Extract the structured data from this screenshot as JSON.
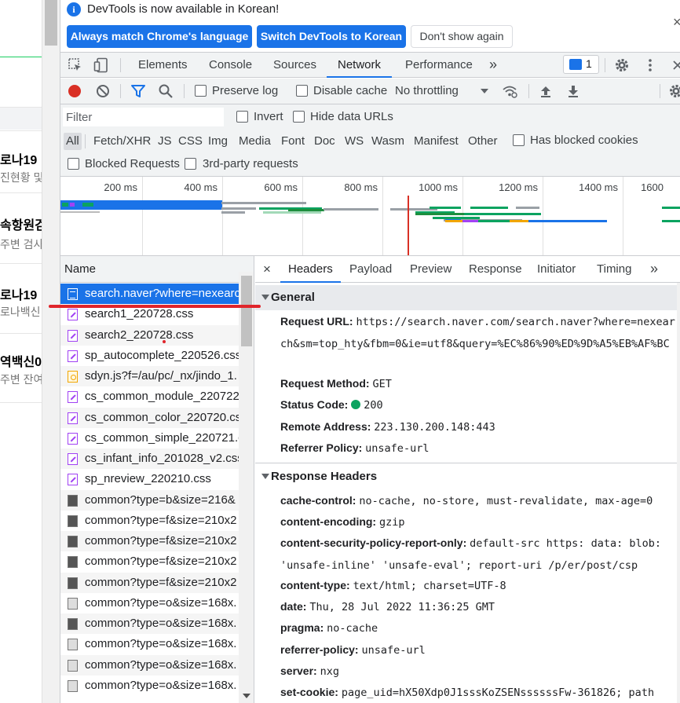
{
  "page_strip": {
    "items": [
      {
        "title": "로나19",
        "sub": "진현황 및"
      },
      {
        "title": "속항원검",
        "sub": "주변 검사"
      },
      {
        "title": "로나19 ",
        "sub": "로나백신"
      },
      {
        "title": "역백신0",
        "sub": "주변 잔여"
      }
    ]
  },
  "infobar": {
    "message": "DevTools is now available in Korean!",
    "btn_match": "Always match Chrome's language",
    "btn_switch": "Switch DevTools to Korean",
    "btn_dismiss": "Don't show again",
    "close": "×"
  },
  "main_tabs": {
    "items": [
      "Elements",
      "Console",
      "Sources",
      "Network",
      "Performance"
    ],
    "active": "Network",
    "more": "»",
    "issues_count": "1"
  },
  "toolbar": {
    "preserve_log": "Preserve log",
    "disable_cache": "Disable cache",
    "throttling": "No throttling"
  },
  "filter": {
    "placeholder": "Filter",
    "invert": "Invert",
    "hide_data_urls": "Hide data URLs",
    "types": [
      "All",
      "Fetch/XHR",
      "JS",
      "CSS",
      "Img",
      "Media",
      "Font",
      "Doc",
      "WS",
      "Wasm",
      "Manifest",
      "Other"
    ],
    "active_type": "All",
    "has_blocked_cookies": "Has blocked cookies",
    "blocked_requests": "Blocked Requests",
    "third_party": "3rd-party requests"
  },
  "overview": {
    "ticks": [
      "200 ms",
      "400 ms",
      "600 ms",
      "800 ms",
      "1000 ms",
      "1200 ms",
      "1400 ms",
      "1600"
    ]
  },
  "request_list": {
    "header": "Name",
    "rows": [
      {
        "name": "search.naver?where=nexearch",
        "type": "doc"
      },
      {
        "name": "search1_220728.css",
        "type": "css"
      },
      {
        "name": "search2_220728.css",
        "type": "css"
      },
      {
        "name": "sp_autocomplete_220526.css",
        "type": "css"
      },
      {
        "name": "sdyn.js?f=/au/pc/_nx/jindo_1.",
        "type": "js"
      },
      {
        "name": "cs_common_module_220722.",
        "type": "css"
      },
      {
        "name": "cs_common_color_220720.css",
        "type": "css"
      },
      {
        "name": "cs_common_simple_220721.c",
        "type": "css"
      },
      {
        "name": "cs_infant_info_201028_v2.css",
        "type": "css"
      },
      {
        "name": "sp_nreview_220210.css",
        "type": "css"
      },
      {
        "name": "common?type=b&size=216&",
        "type": "img"
      },
      {
        "name": "common?type=f&size=210x2",
        "type": "img"
      },
      {
        "name": "common?type=f&size=210x2",
        "type": "img"
      },
      {
        "name": "common?type=f&size=210x2",
        "type": "img"
      },
      {
        "name": "common?type=f&size=210x2",
        "type": "img"
      },
      {
        "name": "common?type=o&size=168x.",
        "type": "img-light"
      },
      {
        "name": "common?type=o&size=168x.",
        "type": "img"
      },
      {
        "name": "common?type=o&size=168x.",
        "type": "img-light"
      },
      {
        "name": "common?type=o&size=168x.",
        "type": "img-light"
      },
      {
        "name": "common?type=o&size=168x.",
        "type": "img-light"
      }
    ]
  },
  "detail": {
    "tabs": [
      "Headers",
      "Payload",
      "Preview",
      "Response",
      "Initiator",
      "Timing"
    ],
    "active_tab": "Headers",
    "close": "×",
    "more": "»",
    "general": {
      "title": "General",
      "rows": [
        {
          "key": "Request URL:",
          "value": "https://search.naver.com/search.naver?where=nexearch&sm=top_hty&fbm=0&ie=utf8&query=%EC%86%90%ED%9D%A5%EB%AF%BC"
        },
        {
          "key": "Request Method:",
          "value": "GET"
        },
        {
          "key": "Status Code:",
          "value": "200"
        },
        {
          "key": "Remote Address:",
          "value": "223.130.200.148:443"
        },
        {
          "key": "Referrer Policy:",
          "value": "unsafe-url"
        }
      ]
    },
    "response_headers": {
      "title": "Response Headers",
      "rows": [
        {
          "key": "cache-control:",
          "value": "no-cache, no-store, must-revalidate, max-age=0"
        },
        {
          "key": "content-encoding:",
          "value": "gzip"
        },
        {
          "key": "content-security-policy-report-only:",
          "value": "default-src https: data: blob: 'unsafe-inline' 'unsafe-eval'; report-uri /p/er/post/csp"
        },
        {
          "key": "content-type:",
          "value": "text/html; charset=UTF-8"
        },
        {
          "key": "date:",
          "value": "Thu, 28 Jul 2022 11:36:25 GMT"
        },
        {
          "key": "pragma:",
          "value": "no-cache"
        },
        {
          "key": "referrer-policy:",
          "value": "unsafe-url"
        },
        {
          "key": "server:",
          "value": "nxg"
        },
        {
          "key": "set-cookie:",
          "value": "page_uid=hX50Xdp0J1sssKoZSENssssssFw-361826; path"
        }
      ]
    }
  },
  "colors": {
    "accent": "#1a73e8",
    "record_red": "#d93025",
    "status_green": "#0ba360",
    "annotation_red": "#e0252b"
  }
}
